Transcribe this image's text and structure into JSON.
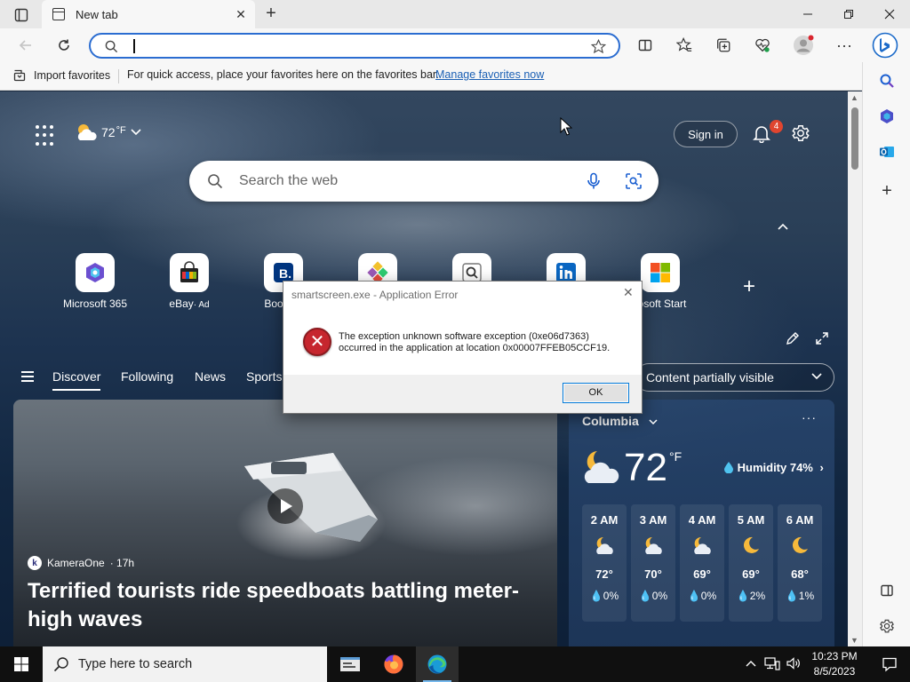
{
  "browser": {
    "tab": {
      "title": "New tab"
    },
    "address": {
      "value": "",
      "placeholder": ""
    },
    "favorites_bar": {
      "import_label": "Import favorites",
      "message": "For quick access, place your favorites here on the favorites bar.",
      "link": "Manage favorites now"
    }
  },
  "newtab": {
    "weather_mini": {
      "temp": "72",
      "unit": "°F"
    },
    "signin_label": "Sign in",
    "notifications_count": "4",
    "search_placeholder": "Search the web",
    "tiles": [
      {
        "label": "Microsoft 365",
        "ad": ""
      },
      {
        "label": "eBay",
        "ad": "· Ad"
      },
      {
        "label": "Booking",
        "ad": ""
      },
      {
        "label": "",
        "ad": ""
      },
      {
        "label": "",
        "ad": ""
      },
      {
        "label": "",
        "ad": ""
      },
      {
        "label": "rosoft Start",
        "ad": ""
      }
    ],
    "nav": [
      "Discover",
      "Following",
      "News",
      "Sports"
    ],
    "content_visibility": "Content partially visible",
    "hero": {
      "source": "KameraOne",
      "source_initial": "k",
      "age": "· 17h",
      "headline": "Terrified tourists ride speedboats battling meter-high waves"
    },
    "weather": {
      "location": "Columbia",
      "temp": "72",
      "unit": "°F",
      "humidity": "Humidity 74%",
      "hourly": [
        {
          "hour": "2 AM",
          "icon": "partly-cloudy-night-icon",
          "temp": "72°",
          "precip": "0%"
        },
        {
          "hour": "3 AM",
          "icon": "partly-cloudy-night-icon",
          "temp": "70°",
          "precip": "0%"
        },
        {
          "hour": "4 AM",
          "icon": "partly-cloudy-night-icon",
          "temp": "69°",
          "precip": "0%"
        },
        {
          "hour": "5 AM",
          "icon": "moon-icon",
          "temp": "69°",
          "precip": "2%"
        },
        {
          "hour": "6 AM",
          "icon": "moon-icon",
          "temp": "68°",
          "precip": "1%"
        }
      ]
    }
  },
  "dialog": {
    "title": "smartscreen.exe - Application Error",
    "message_line1": "The exception unknown software exception (0xe06d7363)",
    "message_line2": "occurred in the application at location 0x00007FFEB05CCF19.",
    "ok_label": "OK"
  },
  "taskbar": {
    "search_placeholder": "Type here to search",
    "time": "10:23 PM",
    "date": "8/5/2023"
  },
  "colors": {
    "accent": "#2b6dd1",
    "error_red": "#c6262e",
    "taskbar": "#101010",
    "notification_badge": "#e0452f"
  }
}
